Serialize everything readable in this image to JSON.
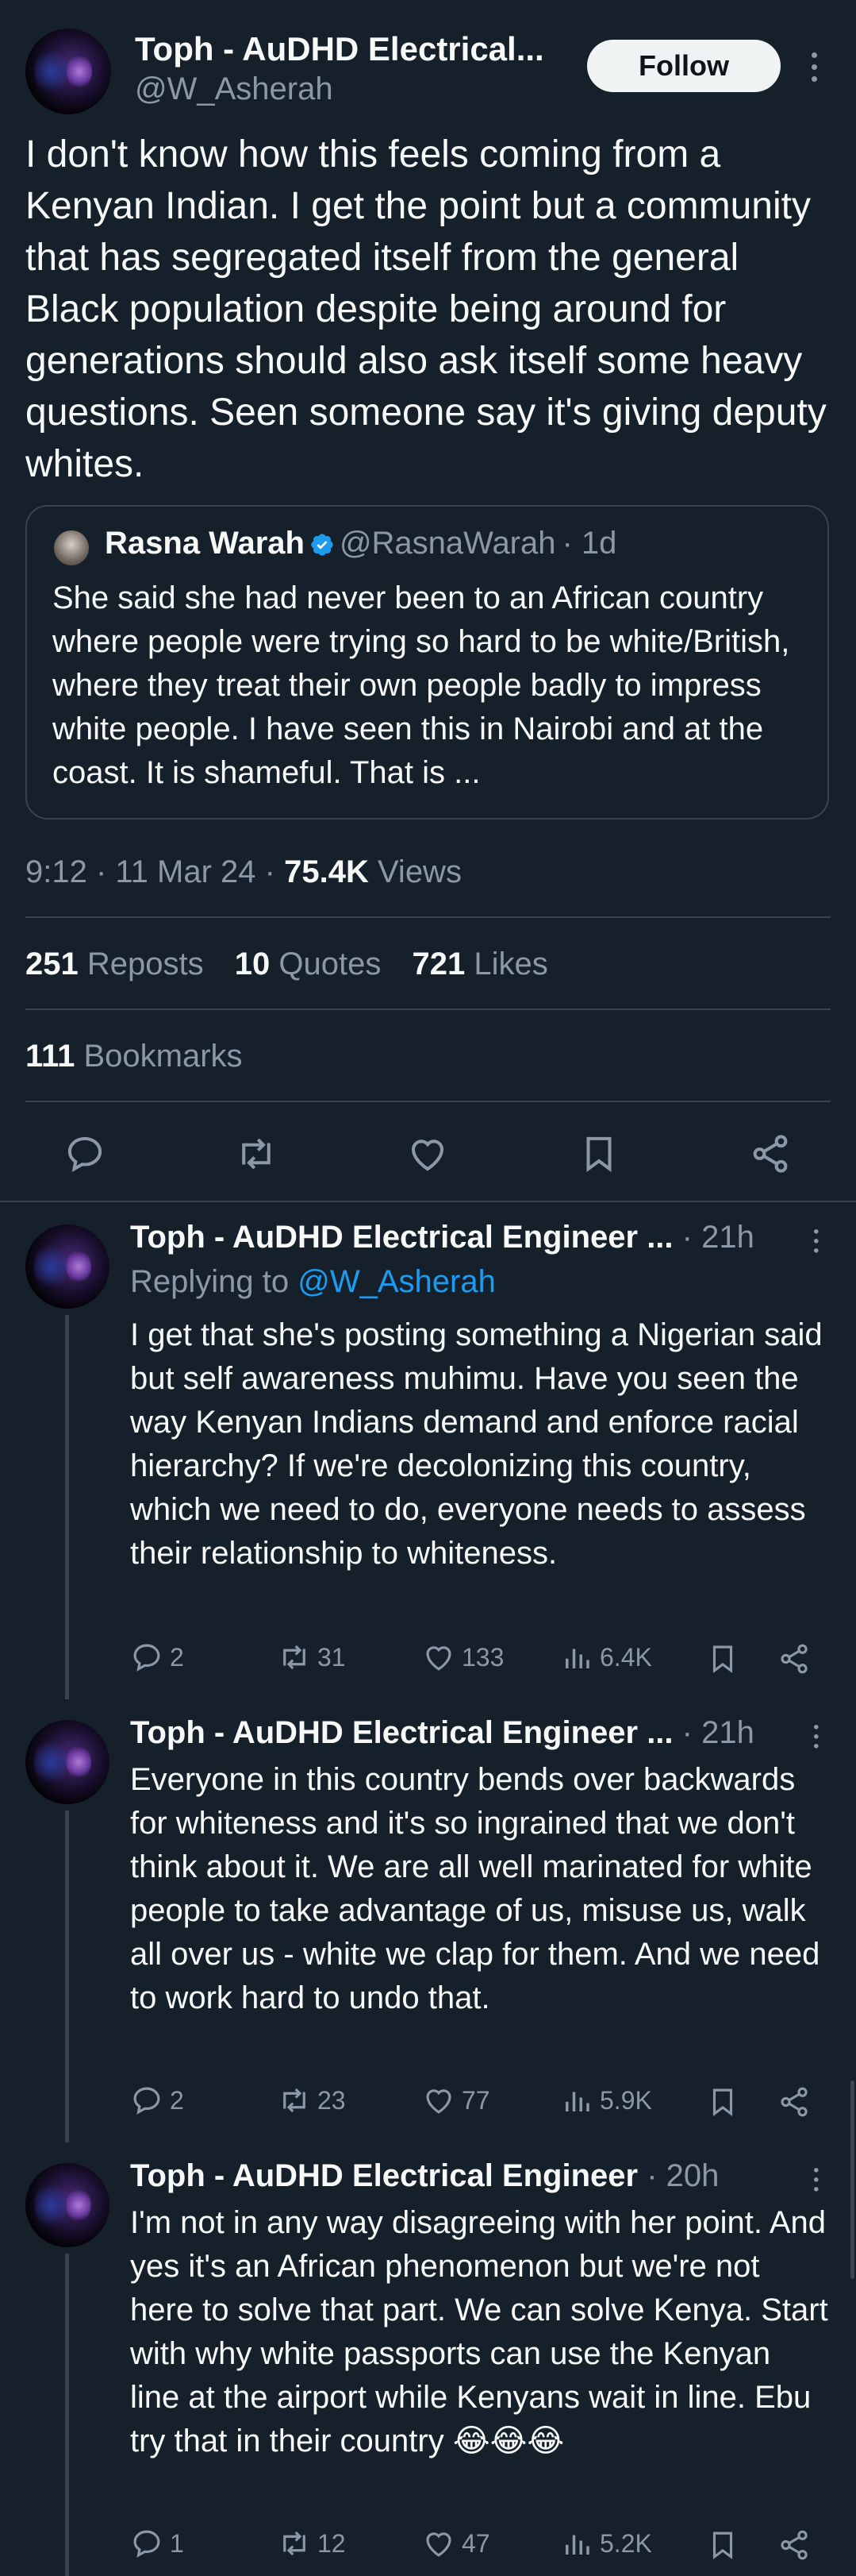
{
  "post": {
    "author_name": "Toph - AuDHD Electrical...",
    "author_handle": "@W_Asherah",
    "follow_label": "Follow",
    "text": "I don't know how this feels coming from a Kenyan Indian. I get the point but a community that has segregated itself from the general Black population despite being around for generations should also ask itself some heavy questions. Seen someone say it's giving deputy whites.",
    "quote": {
      "author_name": "Rasna Warah",
      "author_handle": "@RasnaWarah",
      "time": "· 1d",
      "text": "She said she had never been to an African country where people were trying so hard to be white/British, where they treat their own people badly to impress white people. I have seen this in Nairobi and at the coast. It is shameful. That is ..."
    },
    "timestamp": "9:12 · 11 Mar 24 ·",
    "views_count": "75.4K",
    "views_label": "Views",
    "reposts_count": "251",
    "reposts_label": "Reposts",
    "quotes_count": "10",
    "quotes_label": "Quotes",
    "likes_count": "721",
    "likes_label": "Likes",
    "bookmarks_count": "111",
    "bookmarks_label": "Bookmarks"
  },
  "replies": [
    {
      "name": "Toph - AuDHD Electrical Engineer ...",
      "time": "· 21h",
      "replying_prefix": "Replying to",
      "replying_to": "@W_Asherah",
      "text": "I get that she's posting something a Nigerian said but self awareness muhimu. Have you seen the way Kenyan Indians demand and enforce racial hierarchy? If we're decolonizing this country, which we need to do, everyone needs to assess their relationship to whiteness.",
      "replies": "2",
      "reposts": "31",
      "likes": "133",
      "views": "6.4K"
    },
    {
      "name": "Toph - AuDHD Electrical Engineer ...",
      "time": "· 21h",
      "text": "Everyone in this country bends over backwards for whiteness and it's so ingrained that we don't think about it. We are all well marinated for white people to take advantage of us, misuse us, walk all over us - white we clap for them. And we need to work hard to undo that.",
      "replies": "2",
      "reposts": "23",
      "likes": "77",
      "views": "5.9K"
    },
    {
      "name": "Toph - AuDHD Electrical Engineer",
      "time": "· 20h",
      "text": "I'm not in any way disagreeing with her point. And yes it's an African phenomenon but we're not here to solve that part. We can solve Kenya. Start with why white passports can use the Kenyan line at the airport while Kenyans wait in line. Ebu try that in their country 😂😂😂",
      "replies": "1",
      "reposts": "12",
      "likes": "47",
      "views": "5.2K"
    }
  ],
  "colors": {
    "background": "#15202b",
    "text": "#f7f9f9",
    "muted": "#8b98a5",
    "accent": "#1d9bf0",
    "border": "#38444d"
  }
}
